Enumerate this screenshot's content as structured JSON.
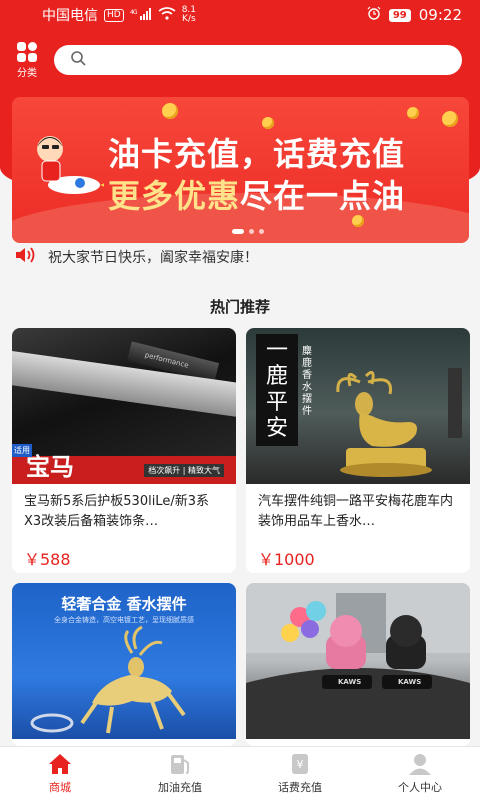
{
  "status_bar": {
    "carrier": "中国电信",
    "hd": "HD",
    "signal": "4G",
    "speed_value": "8.1",
    "speed_unit": "K/s",
    "battery": "99",
    "time": "09:22"
  },
  "header": {
    "category_label": "分类",
    "search_placeholder": ""
  },
  "banner": {
    "line1": "油卡充值，话费充值",
    "line2_part1": "更多优惠",
    "line2_part2": "尽在一点油",
    "active_dot": 0
  },
  "notice": {
    "text": "祝大家节日快乐，阖家幸福安康！"
  },
  "section": {
    "title": "热门推荐"
  },
  "products": [
    {
      "title": "宝马新5系后护板530liLe/新3系X3改装后备箱装饰条…",
      "price": "￥588",
      "image_texts": {
        "badge": "适用",
        "brand": "宝马",
        "plate": "performance",
        "sub": "档次飙升 | 精致大气"
      }
    },
    {
      "title": "汽车摆件纯铜一路平安梅花鹿车内装饰用品车上香水…",
      "price": "￥1000",
      "image_texts": {
        "vertical": "一鹿平安",
        "small": "麋鹿香水摆件"
      }
    },
    {
      "title": "",
      "price": "",
      "image_texts": {
        "headline": "轻奢合金 香水摆件",
        "sub": "全身合金铸造，高空电镀工艺，呈现细腻质感"
      }
    },
    {
      "title": "",
      "price": "",
      "image_texts": {
        "brand": "KAWS"
      }
    }
  ],
  "tabbar": [
    {
      "label": "商城",
      "icon": "home-icon",
      "active": true
    },
    {
      "label": "加油充值",
      "icon": "fuel-pump-icon",
      "active": false
    },
    {
      "label": "话费充值",
      "icon": "phone-bill-icon",
      "active": false
    },
    {
      "label": "个人中心",
      "icon": "user-icon",
      "active": false
    }
  ],
  "colors": {
    "brand_red": "#e8231f",
    "price_red": "#e8231f",
    "banner_yellow": "#ffe38a",
    "tab_inactive": "#333333"
  }
}
